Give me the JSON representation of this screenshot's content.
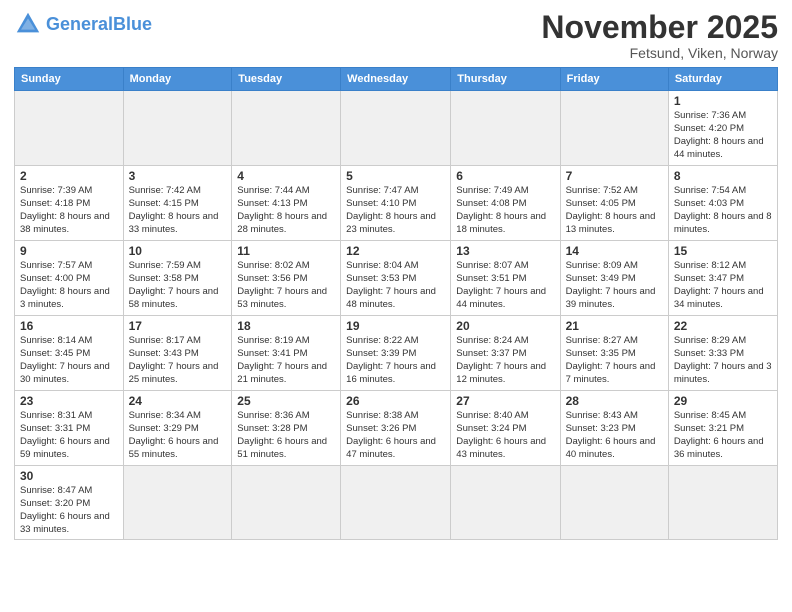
{
  "header": {
    "logo_general": "General",
    "logo_blue": "Blue",
    "month_title": "November 2025",
    "subtitle": "Fetsund, Viken, Norway"
  },
  "days_of_week": [
    "Sunday",
    "Monday",
    "Tuesday",
    "Wednesday",
    "Thursday",
    "Friday",
    "Saturday"
  ],
  "weeks": [
    [
      {
        "day": "",
        "info": ""
      },
      {
        "day": "",
        "info": ""
      },
      {
        "day": "",
        "info": ""
      },
      {
        "day": "",
        "info": ""
      },
      {
        "day": "",
        "info": ""
      },
      {
        "day": "",
        "info": ""
      },
      {
        "day": "1",
        "info": "Sunrise: 7:36 AM\nSunset: 4:20 PM\nDaylight: 8 hours and 44 minutes."
      }
    ],
    [
      {
        "day": "2",
        "info": "Sunrise: 7:39 AM\nSunset: 4:18 PM\nDaylight: 8 hours and 38 minutes."
      },
      {
        "day": "3",
        "info": "Sunrise: 7:42 AM\nSunset: 4:15 PM\nDaylight: 8 hours and 33 minutes."
      },
      {
        "day": "4",
        "info": "Sunrise: 7:44 AM\nSunset: 4:13 PM\nDaylight: 8 hours and 28 minutes."
      },
      {
        "day": "5",
        "info": "Sunrise: 7:47 AM\nSunset: 4:10 PM\nDaylight: 8 hours and 23 minutes."
      },
      {
        "day": "6",
        "info": "Sunrise: 7:49 AM\nSunset: 4:08 PM\nDaylight: 8 hours and 18 minutes."
      },
      {
        "day": "7",
        "info": "Sunrise: 7:52 AM\nSunset: 4:05 PM\nDaylight: 8 hours and 13 minutes."
      },
      {
        "day": "8",
        "info": "Sunrise: 7:54 AM\nSunset: 4:03 PM\nDaylight: 8 hours and 8 minutes."
      }
    ],
    [
      {
        "day": "9",
        "info": "Sunrise: 7:57 AM\nSunset: 4:00 PM\nDaylight: 8 hours and 3 minutes."
      },
      {
        "day": "10",
        "info": "Sunrise: 7:59 AM\nSunset: 3:58 PM\nDaylight: 7 hours and 58 minutes."
      },
      {
        "day": "11",
        "info": "Sunrise: 8:02 AM\nSunset: 3:56 PM\nDaylight: 7 hours and 53 minutes."
      },
      {
        "day": "12",
        "info": "Sunrise: 8:04 AM\nSunset: 3:53 PM\nDaylight: 7 hours and 48 minutes."
      },
      {
        "day": "13",
        "info": "Sunrise: 8:07 AM\nSunset: 3:51 PM\nDaylight: 7 hours and 44 minutes."
      },
      {
        "day": "14",
        "info": "Sunrise: 8:09 AM\nSunset: 3:49 PM\nDaylight: 7 hours and 39 minutes."
      },
      {
        "day": "15",
        "info": "Sunrise: 8:12 AM\nSunset: 3:47 PM\nDaylight: 7 hours and 34 minutes."
      }
    ],
    [
      {
        "day": "16",
        "info": "Sunrise: 8:14 AM\nSunset: 3:45 PM\nDaylight: 7 hours and 30 minutes."
      },
      {
        "day": "17",
        "info": "Sunrise: 8:17 AM\nSunset: 3:43 PM\nDaylight: 7 hours and 25 minutes."
      },
      {
        "day": "18",
        "info": "Sunrise: 8:19 AM\nSunset: 3:41 PM\nDaylight: 7 hours and 21 minutes."
      },
      {
        "day": "19",
        "info": "Sunrise: 8:22 AM\nSunset: 3:39 PM\nDaylight: 7 hours and 16 minutes."
      },
      {
        "day": "20",
        "info": "Sunrise: 8:24 AM\nSunset: 3:37 PM\nDaylight: 7 hours and 12 minutes."
      },
      {
        "day": "21",
        "info": "Sunrise: 8:27 AM\nSunset: 3:35 PM\nDaylight: 7 hours and 7 minutes."
      },
      {
        "day": "22",
        "info": "Sunrise: 8:29 AM\nSunset: 3:33 PM\nDaylight: 7 hours and 3 minutes."
      }
    ],
    [
      {
        "day": "23",
        "info": "Sunrise: 8:31 AM\nSunset: 3:31 PM\nDaylight: 6 hours and 59 minutes."
      },
      {
        "day": "24",
        "info": "Sunrise: 8:34 AM\nSunset: 3:29 PM\nDaylight: 6 hours and 55 minutes."
      },
      {
        "day": "25",
        "info": "Sunrise: 8:36 AM\nSunset: 3:28 PM\nDaylight: 6 hours and 51 minutes."
      },
      {
        "day": "26",
        "info": "Sunrise: 8:38 AM\nSunset: 3:26 PM\nDaylight: 6 hours and 47 minutes."
      },
      {
        "day": "27",
        "info": "Sunrise: 8:40 AM\nSunset: 3:24 PM\nDaylight: 6 hours and 43 minutes."
      },
      {
        "day": "28",
        "info": "Sunrise: 8:43 AM\nSunset: 3:23 PM\nDaylight: 6 hours and 40 minutes."
      },
      {
        "day": "29",
        "info": "Sunrise: 8:45 AM\nSunset: 3:21 PM\nDaylight: 6 hours and 36 minutes."
      }
    ],
    [
      {
        "day": "30",
        "info": "Sunrise: 8:47 AM\nSunset: 3:20 PM\nDaylight: 6 hours and 33 minutes."
      },
      {
        "day": "",
        "info": ""
      },
      {
        "day": "",
        "info": ""
      },
      {
        "day": "",
        "info": ""
      },
      {
        "day": "",
        "info": ""
      },
      {
        "day": "",
        "info": ""
      },
      {
        "day": "",
        "info": ""
      }
    ]
  ]
}
